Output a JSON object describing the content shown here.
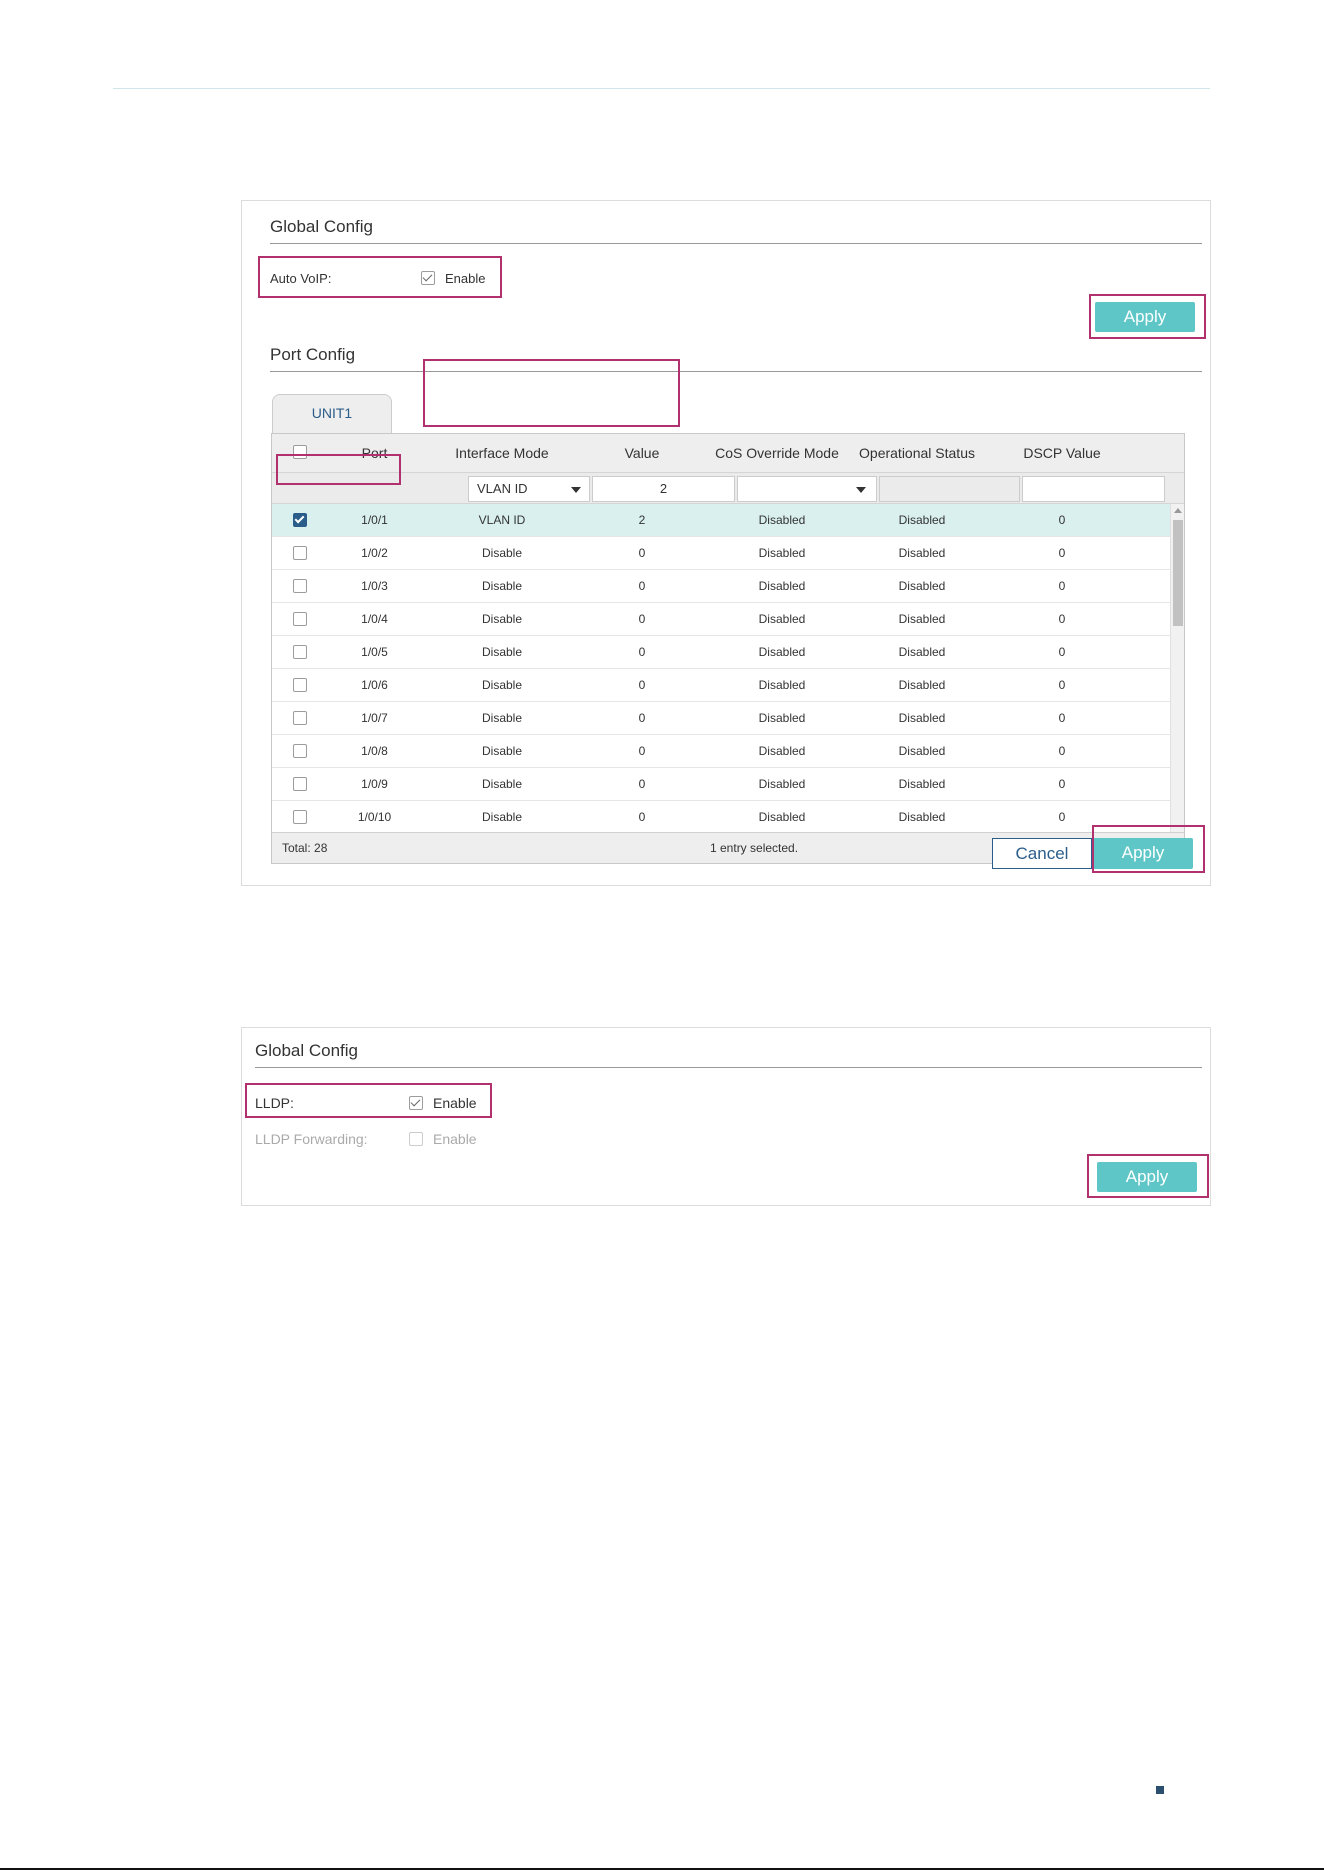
{
  "panel1": {
    "global_title": "Global Config",
    "auto_voip_label": "Auto VoIP:",
    "auto_voip_enable": "Enable",
    "apply_label": "Apply",
    "port_title": "Port Config",
    "tab_label": "UNIT1",
    "columns": [
      "Port",
      "Interface Mode",
      "Value",
      "CoS Override Mode",
      "Operational Status",
      "DSCP Value"
    ],
    "filter": {
      "interface_mode": "VLAN ID",
      "value": "2"
    },
    "rows": [
      {
        "port": "1/0/1",
        "mode": "VLAN ID",
        "value": "2",
        "cos": "Disabled",
        "status": "Disabled",
        "dscp": "0",
        "checked": true
      },
      {
        "port": "1/0/2",
        "mode": "Disable",
        "value": "0",
        "cos": "Disabled",
        "status": "Disabled",
        "dscp": "0",
        "checked": false
      },
      {
        "port": "1/0/3",
        "mode": "Disable",
        "value": "0",
        "cos": "Disabled",
        "status": "Disabled",
        "dscp": "0",
        "checked": false
      },
      {
        "port": "1/0/4",
        "mode": "Disable",
        "value": "0",
        "cos": "Disabled",
        "status": "Disabled",
        "dscp": "0",
        "checked": false
      },
      {
        "port": "1/0/5",
        "mode": "Disable",
        "value": "0",
        "cos": "Disabled",
        "status": "Disabled",
        "dscp": "0",
        "checked": false
      },
      {
        "port": "1/0/6",
        "mode": "Disable",
        "value": "0",
        "cos": "Disabled",
        "status": "Disabled",
        "dscp": "0",
        "checked": false
      },
      {
        "port": "1/0/7",
        "mode": "Disable",
        "value": "0",
        "cos": "Disabled",
        "status": "Disabled",
        "dscp": "0",
        "checked": false
      },
      {
        "port": "1/0/8",
        "mode": "Disable",
        "value": "0",
        "cos": "Disabled",
        "status": "Disabled",
        "dscp": "0",
        "checked": false
      },
      {
        "port": "1/0/9",
        "mode": "Disable",
        "value": "0",
        "cos": "Disabled",
        "status": "Disabled",
        "dscp": "0",
        "checked": false
      },
      {
        "port": "1/0/10",
        "mode": "Disable",
        "value": "0",
        "cos": "Disabled",
        "status": "Disabled",
        "dscp": "0",
        "checked": false
      }
    ],
    "total_label": "Total: 28",
    "selected_label": "1 entry selected.",
    "cancel_label": "Cancel",
    "apply_bottom_label": "Apply"
  },
  "panel2": {
    "global_title": "Global Config",
    "lldp_label": "LLDP:",
    "lldp_enable": "Enable",
    "lldp_fwd_label": "LLDP Forwarding:",
    "lldp_fwd_enable": "Enable",
    "apply_label": "Apply"
  },
  "colors": {
    "accent": "#5ec6c6",
    "highlight": "#b0316d",
    "selected_row": "#d9f0ee",
    "link_blue": "#2b5d8a"
  }
}
